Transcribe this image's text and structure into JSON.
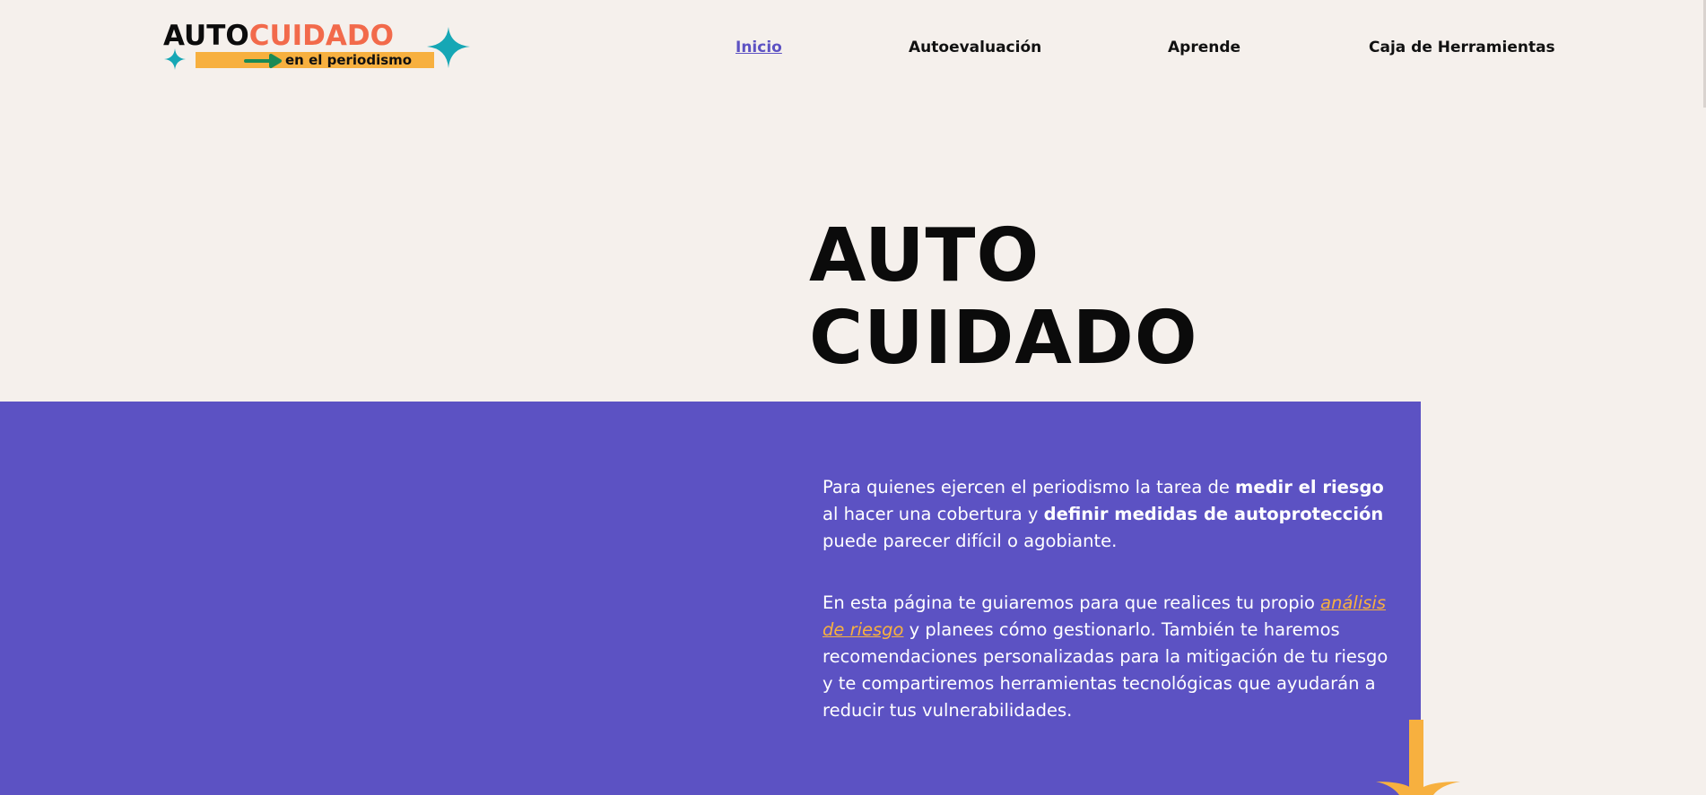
{
  "logo": {
    "word1": "AUTO",
    "word2": "CUIDADO",
    "tagline": "en el periodismo"
  },
  "nav": {
    "items": [
      {
        "label": "Inicio",
        "active": true
      },
      {
        "label": "Autoevaluación",
        "active": false
      },
      {
        "label": "Aprende",
        "active": false
      },
      {
        "label": "Caja de Herramientas",
        "active": false
      }
    ]
  },
  "hero": {
    "title_line1": "AUTO",
    "title_line2": "CUIDADO"
  },
  "intro": {
    "p1": {
      "t1": "Para quienes ejercen el periodismo la tarea de ",
      "b1": "medir el riesgo",
      "t2": " al hacer una cobertura y ",
      "b2": "definir medidas de autoprotección",
      "t3": " puede parecer difícil o agobiante."
    },
    "p2": {
      "t1": "En esta página te guiaremos para que realices tu propio ",
      "link": "análisis de riesgo",
      "t2": " y planees cómo gestionarlo. También te haremos recomendaciones personalizadas para la mitigación de tu riesgo y te compartiremos herramientas tecnológicas que ayudarán a reducir tus vulnerabilidades."
    }
  },
  "colors": {
    "background": "#f5f0ec",
    "purple": "#5c52c3",
    "orange": "#f7b03f",
    "coral": "#f26a4b",
    "teal": "#16a7b5",
    "green": "#1a8a55"
  },
  "icons": [
    "sparkle-icon",
    "arrow-right-icon",
    "sparkle-icon",
    "starburst-decoration-icon"
  ]
}
